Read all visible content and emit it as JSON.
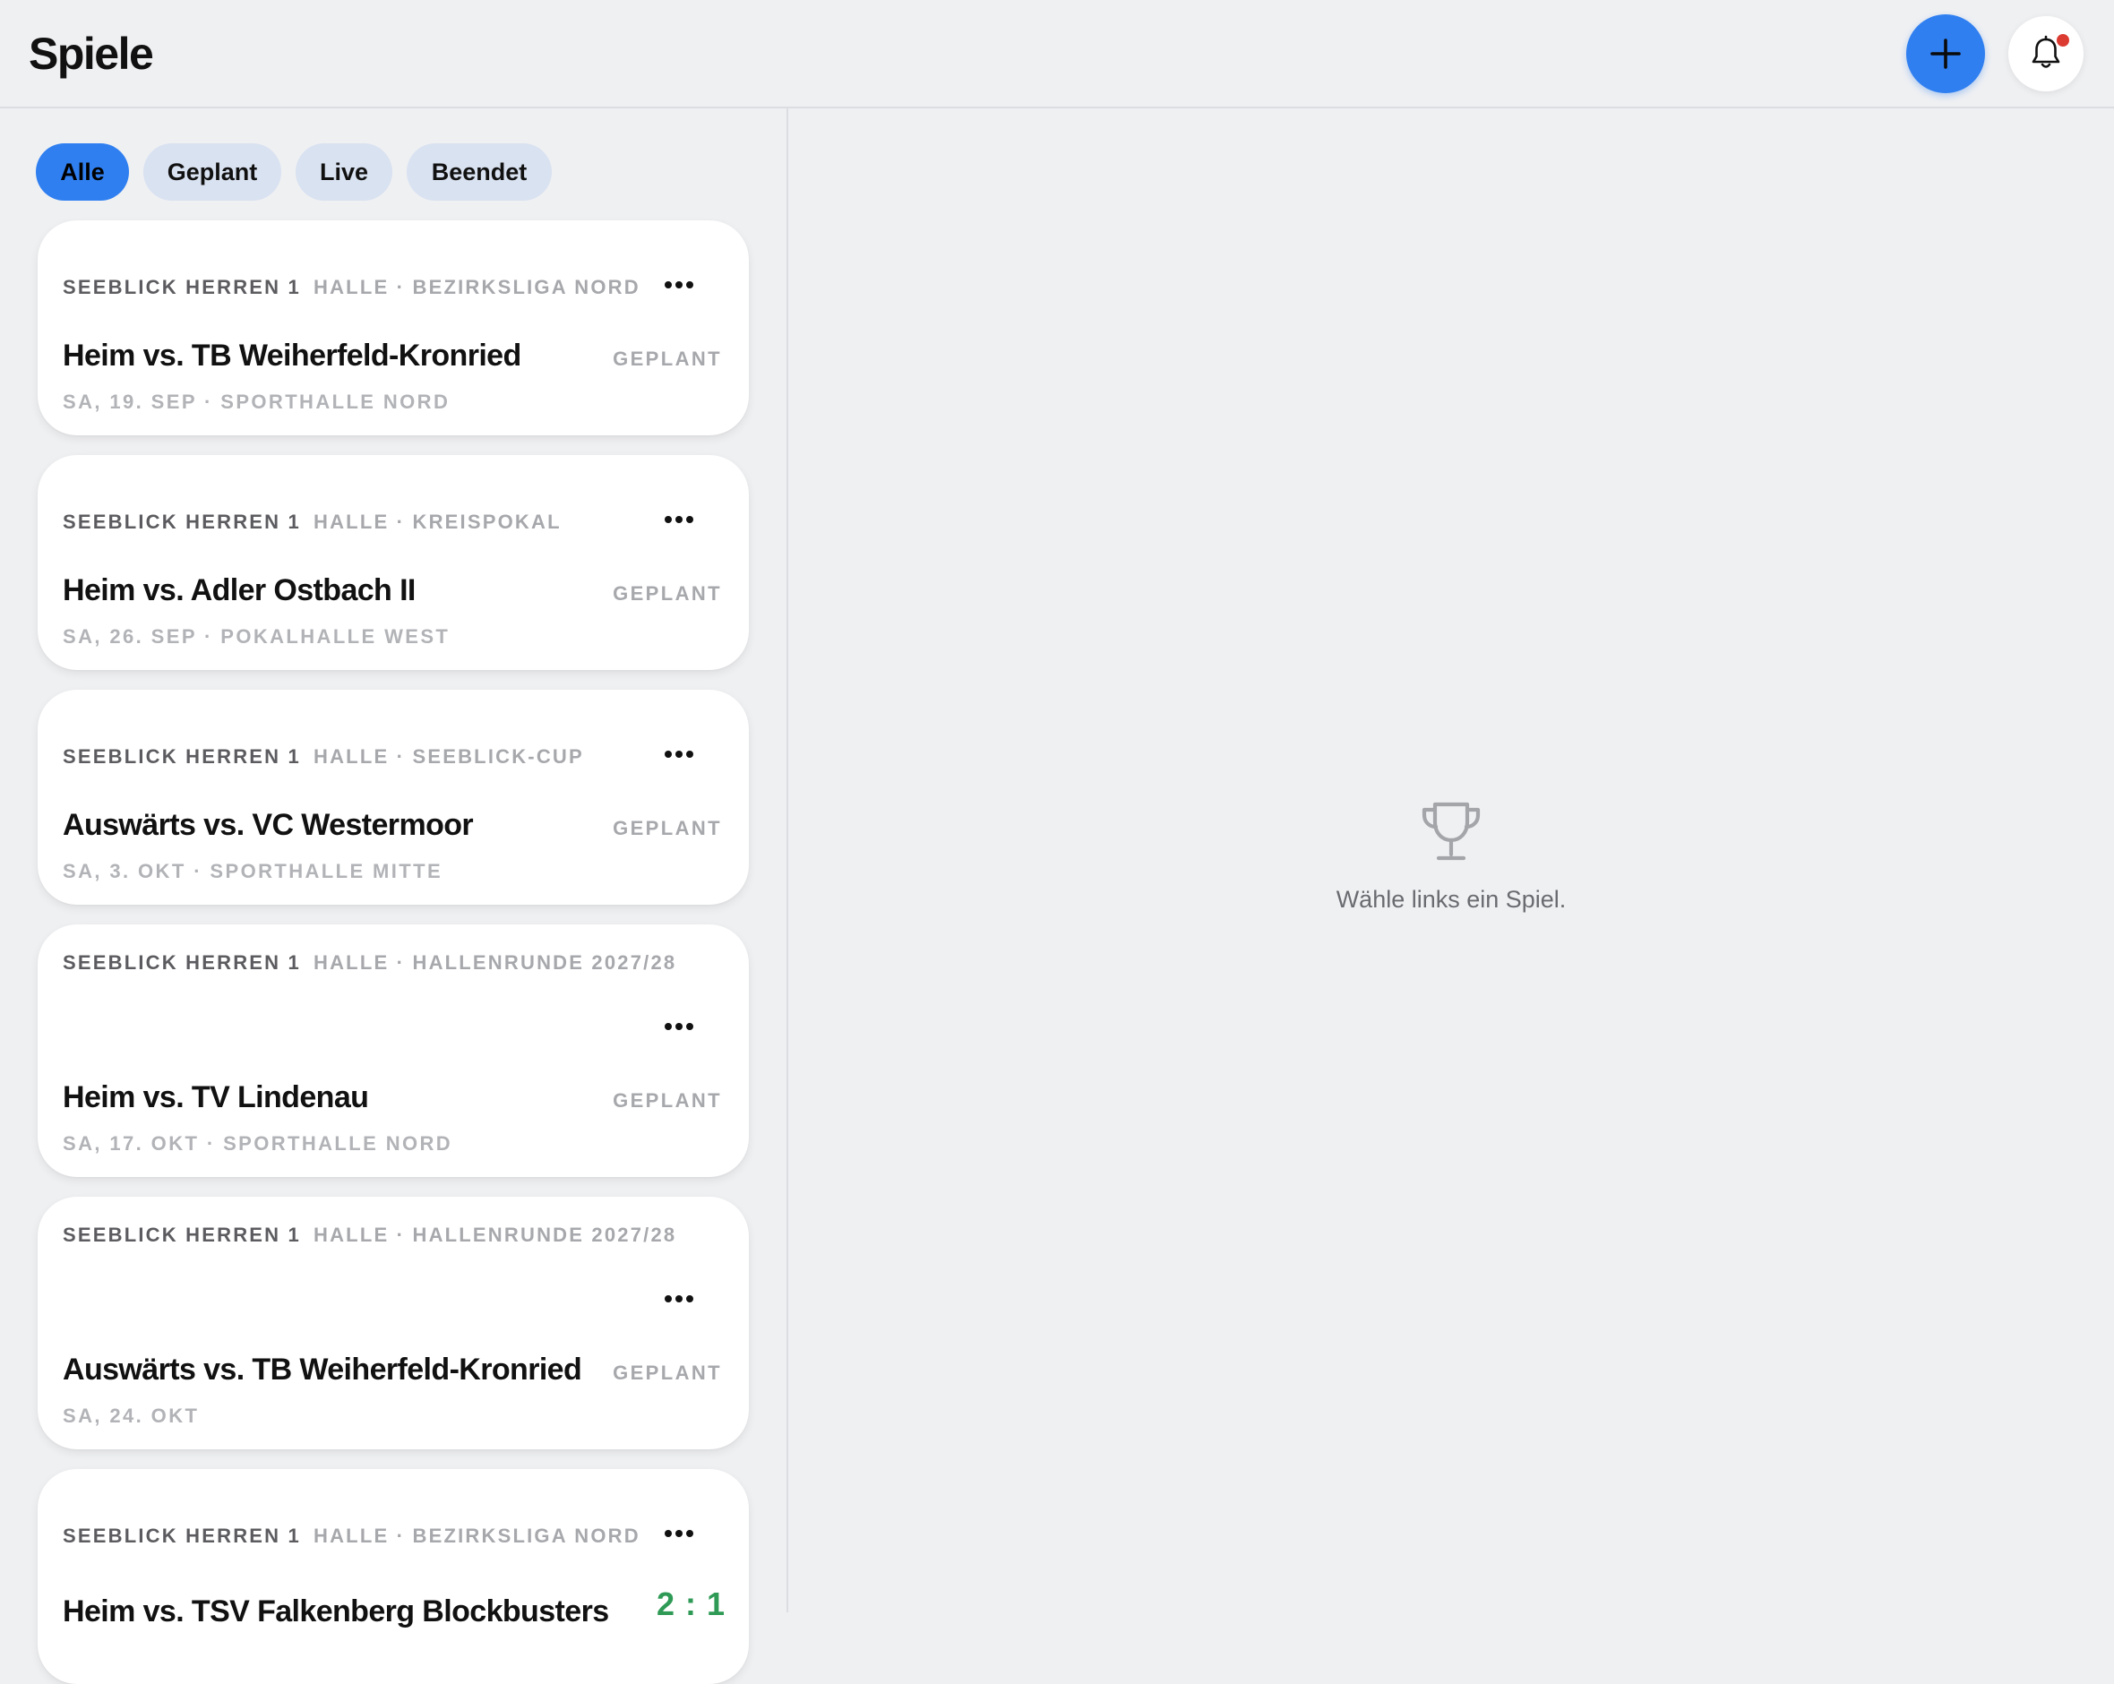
{
  "header": {
    "title": "Spiele",
    "add_icon": "plus-icon",
    "notification_icon": "bell-icon",
    "notification_dot_color": "#dc3b32"
  },
  "filters": [
    {
      "label": "Alle",
      "active": true
    },
    {
      "label": "Geplant",
      "active": false
    },
    {
      "label": "Live",
      "active": false
    },
    {
      "label": "Beendet",
      "active": false
    }
  ],
  "matches": [
    {
      "team": "SEEBLICK HERREN 1",
      "competition": "HALLE · BEZIRKSLIGA NORD",
      "title": "Heim vs. TB Weiherfeld-Kronried",
      "status": "GEPLANT",
      "meta": "SA, 19. SEP · SPORTHALLE NORD"
    },
    {
      "team": "SEEBLICK HERREN 1",
      "competition": "HALLE · KREISPOKAL",
      "title": "Heim vs. Adler Ostbach II",
      "status": "GEPLANT",
      "meta": "SA, 26. SEP · POKALHALLE WEST"
    },
    {
      "team": "SEEBLICK HERREN 1",
      "competition": "HALLE · SEEBLICK-CUP",
      "title": "Auswärts vs. VC Westermoor",
      "status": "GEPLANT",
      "meta": "SA, 3. OKT · SPORTHALLE MITTE"
    },
    {
      "team": "SEEBLICK HERREN 1",
      "competition": "HALLE · HALLENRUNDE 2027/28",
      "title": "Heim vs. TV Lindenau",
      "status": "GEPLANT",
      "meta": "SA, 17. OKT · SPORTHALLE NORD"
    },
    {
      "team": "SEEBLICK HERREN 1",
      "competition": "HALLE · HALLENRUNDE 2027/28",
      "title": "Auswärts vs. TB Weiherfeld-Kronried",
      "status": "GEPLANT",
      "meta": "SA, 24. OKT"
    },
    {
      "team": "SEEBLICK HERREN 1",
      "competition": "HALLE · BEZIRKSLIGA NORD",
      "title": "Heim vs. TSV Falkenberg Blockbusters",
      "score": "2 : 1"
    }
  ],
  "detail": {
    "empty_icon": "trophy-icon",
    "empty_text": "Wähle links ein Spiel."
  },
  "colors": {
    "accent": "#2f7ff1",
    "chip_inactive": "#d9e2f1",
    "score_green": "#2e9a55",
    "background": "#eff0f2"
  }
}
